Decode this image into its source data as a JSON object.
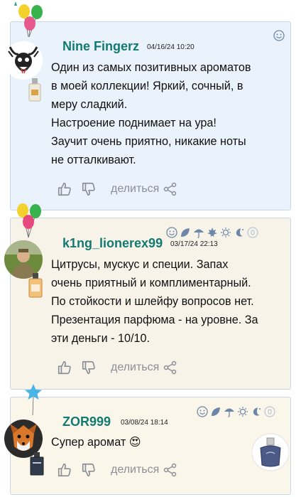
{
  "reviews": [
    {
      "username": "Nine Fingerz",
      "date": "04/16/24 10:20",
      "text": [
        "Один из самых позитивных ароматов",
        "в моей коллекции! Яркий, сочный, в",
        "меру сладкий.",
        "Настроение поднимает на ура!",
        "Заучит очень приятно, никакие ноты",
        "не отталкивают."
      ],
      "share_label": "делиться"
    },
    {
      "username": "k1ng_lionerex99",
      "date": "03/17/24 22:13",
      "text": [
        "Цитрусы, мускус и специи. Запах",
        "очень приятный и комплиментарный.",
        "По стойкости и шлейфу вопросов нет.",
        "Презентация парфюма - на уровне. За",
        "эти деньги - 10/10."
      ],
      "share_label": "делиться"
    },
    {
      "username": "ZOR999",
      "date": "03/08/24 18:14",
      "text": [
        "Супер аромат 😍"
      ],
      "share_label": "делиться"
    }
  ],
  "colors": {
    "username": "#137a72",
    "card1_bg": "#eaf2fb",
    "card2_bg": "#f7f3e9",
    "card3_bg": "#fbf6ea",
    "icon_gray": "#8a8f96",
    "season_blue": "#6c87a8"
  },
  "icons": [
    "balloons-icon",
    "star-balloon-icon",
    "smiley-icon",
    "leaf-icon",
    "umbrella-icon",
    "maple-leaf-icon",
    "sun-icon",
    "moon-icon",
    "thumbs-up-icon",
    "thumbs-down-icon",
    "share-icon"
  ]
}
